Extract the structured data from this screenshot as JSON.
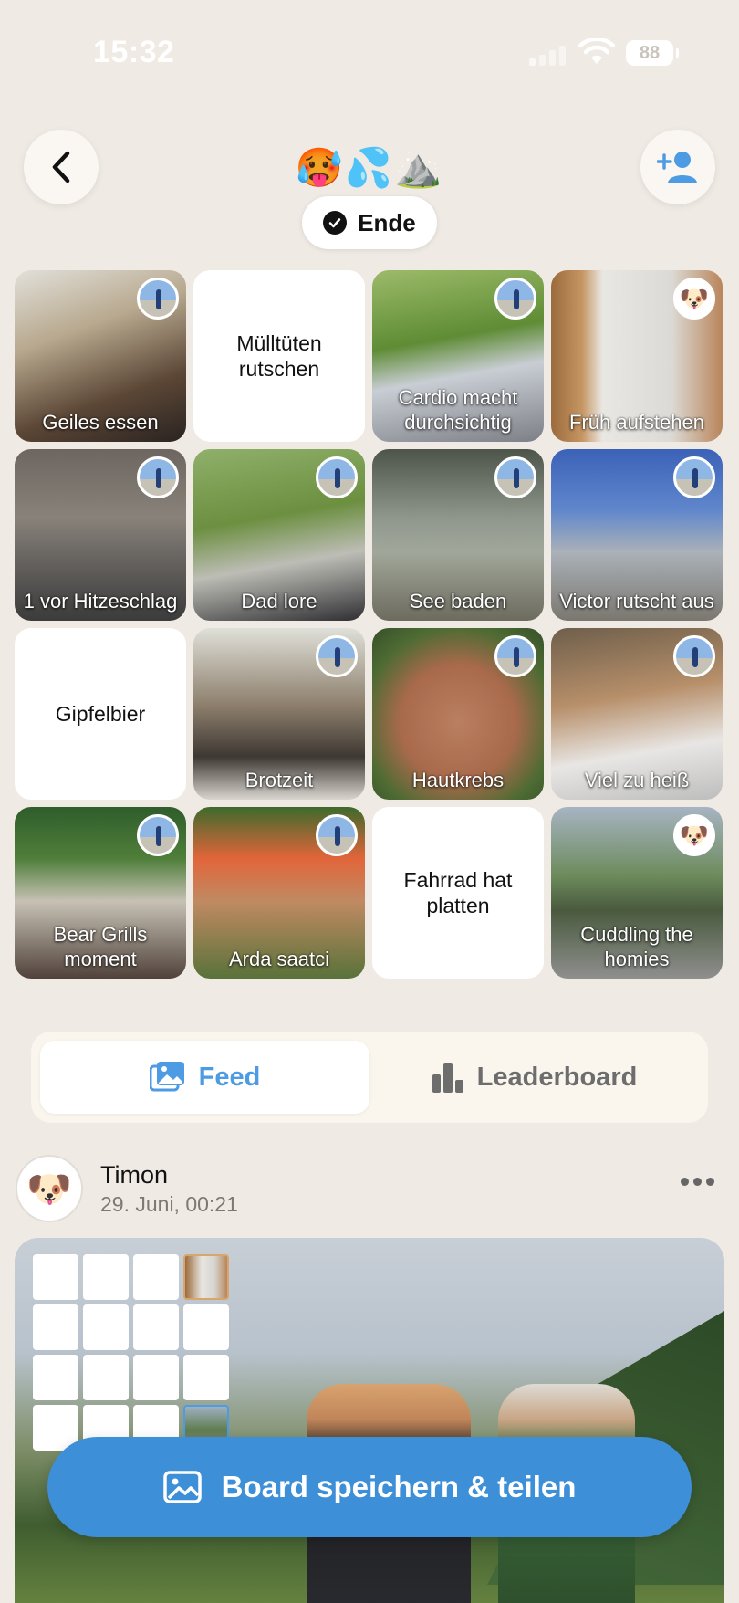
{
  "status_bar": {
    "time": "15:32",
    "battery": "88"
  },
  "header": {
    "emoji_title": "🥵💦⛰️",
    "end_label": "Ende"
  },
  "grid": [
    {
      "label": "Geiles essen",
      "type": "photo",
      "avatar": "person"
    },
    {
      "label": "Mülltüten rutschen",
      "type": "text"
    },
    {
      "label": "Cardio macht durchsichtig",
      "type": "photo",
      "avatar": "person"
    },
    {
      "label": "Früh aufstehen",
      "type": "photo",
      "avatar": "dog"
    },
    {
      "label": "1 vor Hitzeschlag",
      "type": "photo",
      "avatar": "person"
    },
    {
      "label": "Dad lore",
      "type": "photo",
      "avatar": "person"
    },
    {
      "label": "See baden",
      "type": "photo",
      "avatar": "person"
    },
    {
      "label": "Victor rutscht aus",
      "type": "photo",
      "avatar": "person"
    },
    {
      "label": "Gipfelbier",
      "type": "text"
    },
    {
      "label": "Brotzeit",
      "type": "photo",
      "avatar": "person"
    },
    {
      "label": "Hautkrebs",
      "type": "photo",
      "avatar": "person"
    },
    {
      "label": "Viel zu heiß",
      "type": "photo",
      "avatar": "person"
    },
    {
      "label": "Bear Grills moment",
      "type": "photo",
      "avatar": "person"
    },
    {
      "label": "Arda saatci",
      "type": "photo",
      "avatar": "person"
    },
    {
      "label": "Fahrrad hat platten",
      "type": "text"
    },
    {
      "label": "Cuddling the homies",
      "type": "photo",
      "avatar": "dog"
    }
  ],
  "tabs": {
    "feed": "Feed",
    "leaderboard": "Leaderboard"
  },
  "post": {
    "user": "Timon",
    "date": "29. Juni, 00:21",
    "avatar_emoji": "🐶"
  },
  "cta": {
    "label": "Board speichern & teilen"
  },
  "colors": {
    "accent": "#4c9be3",
    "background": "#efeae4",
    "cta": "#3d8fd8"
  },
  "icons": [
    "back-chevron-icon",
    "add-person-icon",
    "check-circle-icon",
    "feed-image-icon",
    "leaderboard-bars-icon",
    "more-dots-icon",
    "image-icon"
  ]
}
